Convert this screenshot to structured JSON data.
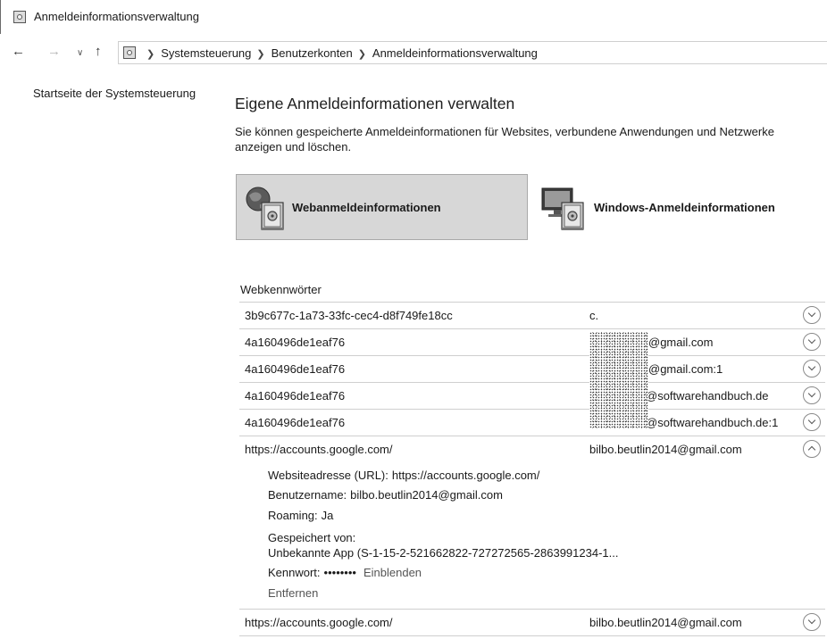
{
  "window": {
    "title": "Anmeldeinformationsverwaltung"
  },
  "breadcrumb": [
    "Systemsteuerung",
    "Benutzerkonten",
    "Anmeldeinformationsverwaltung"
  ],
  "sidebar": {
    "home_link": "Startseite der Systemsteuerung"
  },
  "main": {
    "heading": "Eigene Anmeldeinformationen verwalten",
    "description": "Sie können gespeicherte Anmeldeinformationen für Websites, verbundene Anwendungen und Netzwerke anzeigen und löschen.",
    "categories": [
      {
        "label": "Webanmeldeinformationen",
        "selected": true,
        "icon": "globe-vault-icon"
      },
      {
        "label": "Windows-Anmeldeinformationen",
        "selected": false,
        "icon": "monitor-vault-icon"
      }
    ],
    "section_label": "Webkennwörter",
    "rows": [
      {
        "address": "3b9c677c-1a73-33fc-cec4-d8f749fe18cc",
        "user": "c.",
        "expanded": false
      },
      {
        "address": "4a160496de1eaf76",
        "user": "@gmail.com",
        "expanded": false
      },
      {
        "address": "4a160496de1eaf76",
        "user": "@gmail.com:1",
        "expanded": false
      },
      {
        "address": "4a160496de1eaf76",
        "user": "@softwarehandbuch.de",
        "expanded": false
      },
      {
        "address": "4a160496de1eaf76",
        "user": "@softwarehandbuch.de:1",
        "expanded": false
      },
      {
        "address": "https://accounts.google.com/",
        "user": "bilbo.beutlin2014@gmail.com",
        "expanded": true
      },
      {
        "address": "https://accounts.google.com/",
        "user": "bilbo.beutlin2014@gmail.com",
        "expanded": false
      }
    ],
    "details": {
      "url_label": "Websiteadresse (URL):",
      "url_value": "https://accounts.google.com/",
      "username_label": "Benutzername:",
      "username_value": "bilbo.beutlin2014@gmail.com",
      "roaming_label": "Roaming:",
      "roaming_value": "Ja",
      "saved_by_label": "Gespeichert von:",
      "saved_by_value": "Unbekannte App (S-1-15-2-521662822-727272565-2863991234-1...",
      "password_label": "Kennwort:",
      "password_mask": "••••••••",
      "reveal_link": "Einblenden",
      "remove_link": "Entfernen"
    }
  }
}
